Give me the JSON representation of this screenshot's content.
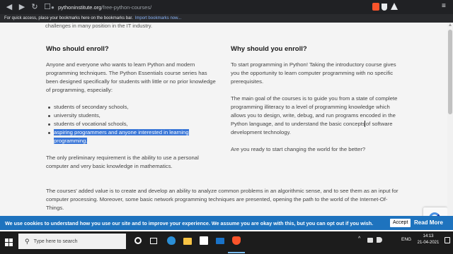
{
  "browser": {
    "url_host": "pythoninstitute.org",
    "url_path": "/free-python-courses/"
  },
  "bookmarks_bar": {
    "message": "For quick access, place your bookmarks here on the bookmarks bar.",
    "import_link": "Import bookmarks now..."
  },
  "page": {
    "cut_off_text": "challenges in many position in the IT industry.",
    "who": {
      "heading": "Who should enroll?",
      "intro": "Anyone and everyone who wants to learn Python and modern programming techniques. The Python Essentials course series has been designed specifically for students with little or no prior knowledge of programming, especially:",
      "items": [
        "students of secondary schools,",
        "university students,",
        "students of vocational schools,"
      ],
      "highlighted_item": "aspiring programmers and anyone interested in learning programming.",
      "requirement": "The only preliminary requirement is the ability to use a personal computer and very basic knowledge in mathematics."
    },
    "why": {
      "heading": "Why should you enroll?",
      "p1": "To start programming in Python! Taking the introductory course gives you the opportunity to learn computer programming with no specific prerequisites.",
      "p2_before_caret": "The main goal of the courses is to guide you from a state of complete programming illiteracy to a level of programming knowledge which allows you to design, write, debug, and run programs encoded in the Python language, and to understand the basic concepts",
      "p2_after_caret": " of software development technology.",
      "p3": "Are you ready to start changing the world for the better?"
    },
    "added_value": "The courses' added value is to create and develop an ability to analyze common problems in an algorithmic sense, and to see them as an input for computer processing. Moreover, some basic network programming techniques are presented, opening the path to the world of the Internet-Of-Things."
  },
  "cookie_bar": {
    "text": "We use cookies to understand how you use our site and to improve your experience. We assume you are okay with this, but you can opt out if you wish.",
    "accept": "Accept",
    "read_more": "Read More",
    "color": "#1e73be"
  },
  "taskbar": {
    "search_placeholder": "Type here to search",
    "lang": "ENG",
    "time": "14:13",
    "date": "21-04-2021"
  }
}
